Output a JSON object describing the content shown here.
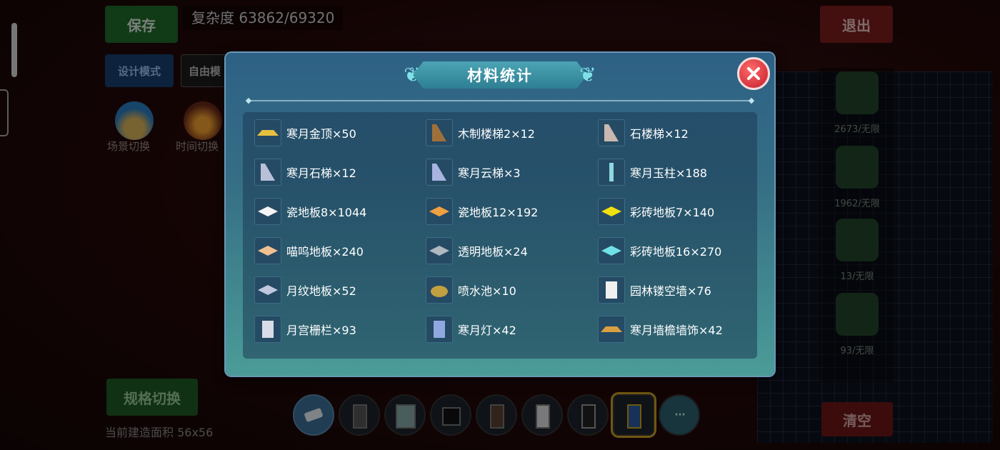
{
  "hud": {
    "save_label": "保存",
    "complexity": "复杂度 63862/69320",
    "exit_label": "退出",
    "design_mode_label": "设计模式",
    "free_mode_label": "自由模",
    "scene_switch_label": "场景切换",
    "time_switch_label": "时间切换",
    "spec_switch_label": "规格切换",
    "build_area": "当前建造面积 56x56",
    "clear_label": "清空",
    "more_label": "···"
  },
  "right_panel": {
    "slots": [
      {
        "label": "2673/无限"
      },
      {
        "label": "1962/无限"
      },
      {
        "label": "13/无限"
      },
      {
        "label": "93/无限"
      }
    ]
  },
  "dialog": {
    "title": "材料统计",
    "items": [
      {
        "text": "寒月金顶×50",
        "icon": "golden-roof-icon",
        "color": "#e8c040"
      },
      {
        "text": "木制楼梯2×12",
        "icon": "wooden-stairs-icon",
        "color": "#a0703a"
      },
      {
        "text": "石楼梯×12",
        "icon": "stone-stairs-icon",
        "color": "#c8b8b0"
      },
      {
        "text": "寒月石梯×12",
        "icon": "stone-ladder-icon",
        "color": "#b8c0d8"
      },
      {
        "text": "寒月云梯×3",
        "icon": "cloud-ladder-icon",
        "color": "#a8b4e0"
      },
      {
        "text": "寒月玉柱×188",
        "icon": "jade-pillar-icon",
        "color": "#8fd8e0"
      },
      {
        "text": "瓷地板8×1044",
        "icon": "white-floor-tile-icon",
        "color": "#f4f4f4"
      },
      {
        "text": "瓷地板12×192",
        "icon": "orange-floor-tile-icon",
        "color": "#f0a040"
      },
      {
        "text": "彩砖地板7×140",
        "icon": "yellow-floor-tile-icon",
        "color": "#f0e010"
      },
      {
        "text": "喵呜地板×240",
        "icon": "cat-floor-tile-icon",
        "color": "#f0c090"
      },
      {
        "text": "透明地板×24",
        "icon": "glass-floor-tile-icon",
        "color": "#b0b8c0"
      },
      {
        "text": "彩砖地板16×270",
        "icon": "cyan-floor-tile-icon",
        "color": "#70e0e8"
      },
      {
        "text": "月纹地板×52",
        "icon": "moon-floor-tile-icon",
        "color": "#c0c8e0"
      },
      {
        "text": "喷水池×10",
        "icon": "fountain-icon",
        "color": "#c0a040"
      },
      {
        "text": "园林镂空墙×76",
        "icon": "lattice-wall-icon",
        "color": "#f0f0f0"
      },
      {
        "text": "月宫栅栏×93",
        "icon": "fence-icon",
        "color": "#d8dce8"
      },
      {
        "text": "寒月灯×42",
        "icon": "lantern-icon",
        "color": "#90a8e0"
      },
      {
        "text": "寒月墙檐墙饰×42",
        "icon": "eave-decoration-icon",
        "color": "#d8a040"
      }
    ]
  }
}
